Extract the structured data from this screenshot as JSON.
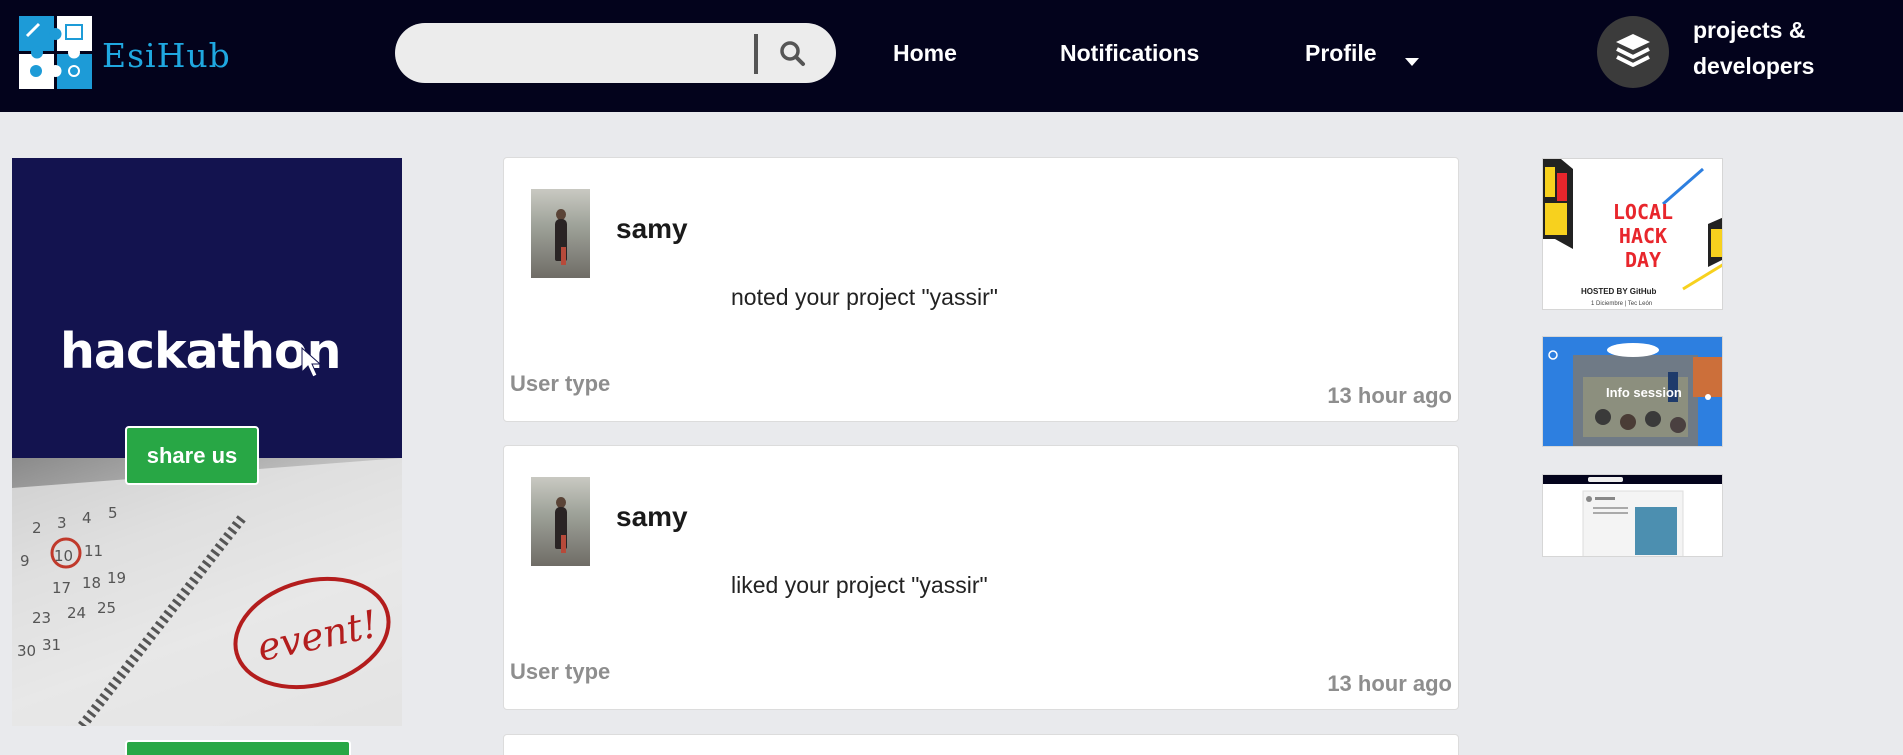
{
  "header": {
    "brand": "EsiHub",
    "search": {
      "placeholder": "",
      "value": ""
    },
    "nav": {
      "home": "Home",
      "notifications": "Notifications",
      "profile": "Profile"
    },
    "projects_developers": "projects & developers"
  },
  "left_ad": {
    "title": "hackathon",
    "share_label": "share us"
  },
  "feed": [
    {
      "name": "samy",
      "message": "noted your project \"yassir\"",
      "user_type": "User type",
      "time": "13 hour ago"
    },
    {
      "name": "samy",
      "message": "liked your project \"yassir\"",
      "user_type": "User type",
      "time": "13 hour ago"
    }
  ],
  "right_thumbs": {
    "local_hack_day": {
      "lines": [
        "LOCAL",
        "HACK",
        "DAY"
      ],
      "host": "HOSTED BY GitHub",
      "date": "1 Diciembre | Tec León"
    },
    "info_session": {
      "title": "Info session"
    }
  },
  "colors": {
    "navbar": "#03031c",
    "brand": "#1fa8e0",
    "page_bg": "#e9eaed",
    "green": "#28a745",
    "muted": "#8e8e8e"
  }
}
